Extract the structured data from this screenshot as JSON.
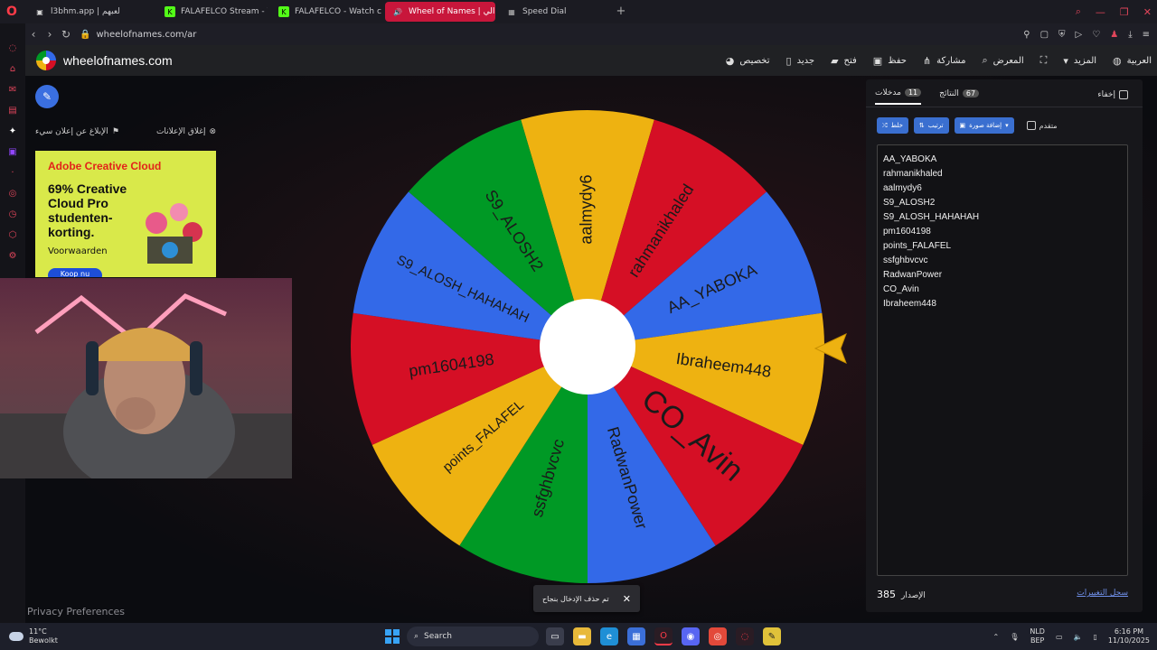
{
  "browser": {
    "tabs": [
      {
        "title": "l3bhm.app | لعبهم",
        "active": false,
        "icon_color": "#dddddd",
        "icon_glyph": "l3"
      },
      {
        "title": "FALAFELCO Stream - Wa",
        "active": false,
        "icon_color": "#53fc18",
        "icon_glyph": "K"
      },
      {
        "title": "FALAFELCO - Watch clip",
        "active": false,
        "icon_color": "#53fc18",
        "icon_glyph": "K"
      },
      {
        "title": "Wheel of Names | الي",
        "active": true,
        "icon_color": "#ffffff",
        "icon_glyph": "◉"
      },
      {
        "title": "Speed Dial",
        "active": false,
        "icon_color": "#bbbbbb",
        "icon_glyph": "▦"
      }
    ],
    "url": "wheelofnames.com/ar"
  },
  "site": {
    "brand": "wheelofnames.com",
    "menu": {
      "customize": "تخصيص",
      "new": "جديد",
      "open": "فتح",
      "save": "حفظ",
      "share": "مشاركة",
      "gallery": "المعرض",
      "more": "المزيد",
      "language": "العربية"
    }
  },
  "ads": {
    "close_ads": "إغلاق الإعلانات",
    "report_ad": "الإبلاغ عن إعلان سيء",
    "brand": "Adobe Creative Cloud",
    "copy": "69% Creative Cloud Pro studenten-korting.",
    "terms": "Voorwaarden",
    "cta": "Koop nu"
  },
  "privacy": "Privacy Preferences",
  "wheel": {
    "segments": [
      {
        "label": "aalmydy6",
        "color": "#eeb211"
      },
      {
        "label": "rahmanikhaled",
        "color": "#d50f25"
      },
      {
        "label": "AA_YABOKA",
        "color": "#3369e8"
      },
      {
        "label": "Ibraheem448",
        "color": "#eeb211"
      },
      {
        "label": "CO_Avin",
        "color": "#d50f25"
      },
      {
        "label": "RadwanPower",
        "color": "#3369e8"
      },
      {
        "label": "ssfghbvcvc",
        "color": "#009925"
      },
      {
        "label": "points_FALAFEL",
        "color": "#eeb211"
      },
      {
        "label": "pm1604198",
        "color": "#d50f25"
      },
      {
        "label": "S9_ALOSH_HAHAHAH",
        "color": "#3369e8"
      },
      {
        "label": "S9_ALOSH2",
        "color": "#009925"
      }
    ],
    "pointer_color": "#eeb211"
  },
  "panel": {
    "tab_entries": "مدخلات",
    "entries_count": "11",
    "tab_results": "النتائج",
    "results_count": "67",
    "hide": "إخفاء",
    "shuffle": "خلط",
    "sort": "ترتيب",
    "add_image": "إضافة صورة",
    "advanced": "متقدم",
    "entries": [
      "AA_YABOKA",
      "rahmanikhaled",
      "aalmydy6",
      "S9_ALOSH2",
      "S9_ALOSH_HAHAHAH",
      "pm1604198",
      "points_FALAFEL",
      "ssfghbvcvc",
      "RadwanPower",
      "CO_Avin",
      "Ibraheem448"
    ],
    "version_label": "الإصدار",
    "version": "385",
    "changelog": "سجل التغييرات"
  },
  "toast": {
    "message": "تم حذف الإدخال بنجاح",
    "close": "✕"
  },
  "taskbar": {
    "temp": "11°C",
    "weather": "Bewolkt",
    "search": "Search",
    "lang1": "NLD",
    "lang2": "BEP",
    "time": "6:16 PM",
    "date": "11/10/2025"
  }
}
